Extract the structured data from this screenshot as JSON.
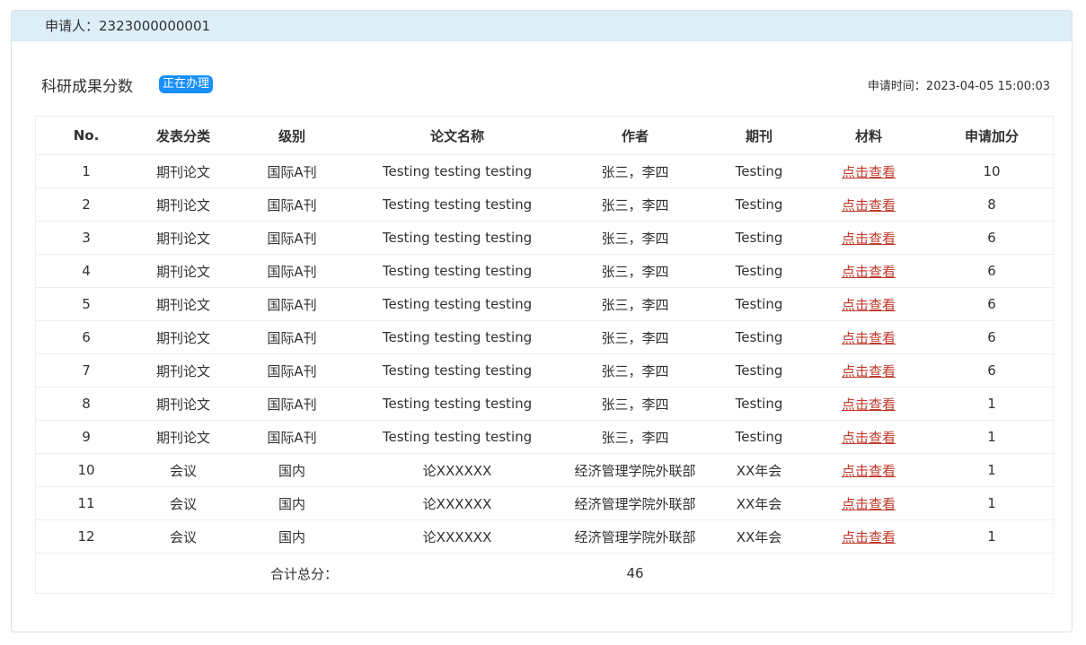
{
  "header": {
    "applicant_label": "申请人：2323000000001"
  },
  "title_row": {
    "title": "科研成果分数",
    "status_badge": "正在办理",
    "apply_time": "申请时间：2023-04-05  15:00:03"
  },
  "table": {
    "columns": [
      "No.",
      "发表分类",
      "级别",
      "论文名称",
      "作者",
      "期刊",
      "材料",
      "申请加分"
    ],
    "rows": [
      [
        "1",
        "期刊论文",
        "国际A刊",
        "Testing testing testing",
        "张三，李四",
        "Testing",
        "点击查看",
        "10"
      ],
      [
        "2",
        "期刊论文",
        "国际A刊",
        "Testing testing testing",
        "张三，李四",
        "Testing",
        "点击查看",
        "8"
      ],
      [
        "3",
        "期刊论文",
        "国际A刊",
        "Testing testing testing",
        "张三，李四",
        "Testing",
        "点击查看",
        "6"
      ],
      [
        "4",
        "期刊论文",
        "国际A刊",
        "Testing testing testing",
        "张三，李四",
        "Testing",
        "点击查看",
        "6"
      ],
      [
        "5",
        "期刊论文",
        "国际A刊",
        "Testing testing testing",
        "张三，李四",
        "Testing",
        "点击查看",
        "6"
      ],
      [
        "6",
        "期刊论文",
        "国际A刊",
        "Testing testing testing",
        "张三，李四",
        "Testing",
        "点击查看",
        "6"
      ],
      [
        "7",
        "期刊论文",
        "国际A刊",
        "Testing testing testing",
        "张三，李四",
        "Testing",
        "点击查看",
        "6"
      ],
      [
        "8",
        "期刊论文",
        "国际A刊",
        "Testing testing testing",
        "张三，李四",
        "Testing",
        "点击查看",
        "1"
      ],
      [
        "9",
        "期刊论文",
        "国际A刊",
        "Testing testing testing",
        "张三，李四",
        "Testing",
        "点击查看",
        "1"
      ],
      [
        "10",
        "会议",
        "国内",
        "论XXXXXX",
        "经济管理学院外联部",
        "XX年会",
        "点击查看",
        "1"
      ],
      [
        "11",
        "会议",
        "国内",
        "论XXXXXX",
        "经济管理学院外联部",
        "XX年会",
        "点击查看",
        "1"
      ],
      [
        "12",
        "会议",
        "国内",
        "论XXXXXX",
        "经济管理学院外联部",
        "XX年会",
        "点击查看",
        "1"
      ]
    ],
    "total_label": "合计总分：",
    "total_value": "46"
  },
  "colors": {
    "header_bg": "#ddeef9",
    "badge": "#1890ff",
    "link": "#c0392b"
  }
}
